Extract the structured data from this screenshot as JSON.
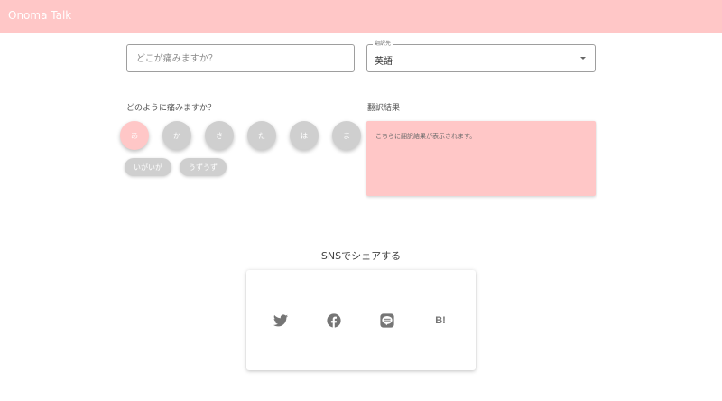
{
  "app": {
    "title": "Onoma Talk"
  },
  "colors": {
    "accent": "#ffc7c7",
    "inactive": "#cfcfcf",
    "icon": "#757575"
  },
  "input": {
    "placeholder": "どこが痛みますか？",
    "value": ""
  },
  "select": {
    "legend": "翻訳先",
    "value": "英語"
  },
  "question": {
    "label": "どのように痛みますか？"
  },
  "kana_buttons": [
    "あ",
    "か",
    "さ",
    "た",
    "は",
    "ま"
  ],
  "kana_selected": "あ",
  "chips": [
    "いがいが",
    "うずうず"
  ],
  "result": {
    "label": "翻訳結果",
    "text": "こちらに翻訳結果が表示されます。"
  },
  "share": {
    "title": "SNSでシェアする",
    "icons": [
      "twitter-icon",
      "facebook-icon",
      "line-icon",
      "hatena-bookmark-icon"
    ],
    "hatena_text": "B!"
  }
}
